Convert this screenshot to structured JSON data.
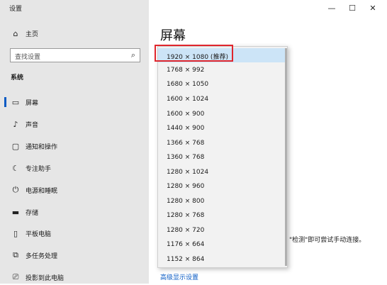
{
  "window": {
    "title": "设置",
    "controls": [
      "minimize-icon",
      "maximize-icon",
      "close-icon"
    ]
  },
  "sidebar": {
    "home": {
      "label": "主页",
      "icon": "home-icon"
    },
    "search": {
      "placeholder": "查找设置",
      "icon": "search-icon"
    },
    "section_title": "系统",
    "items": [
      {
        "label": "屏幕",
        "icon": "display-icon",
        "selected": true
      },
      {
        "label": "声音",
        "icon": "sound-icon"
      },
      {
        "label": "通知和操作",
        "icon": "notification-icon"
      },
      {
        "label": "专注助手",
        "icon": "moon-icon"
      },
      {
        "label": "电源和睡眠",
        "icon": "power-icon"
      },
      {
        "label": "存储",
        "icon": "storage-icon"
      },
      {
        "label": "平板电脑",
        "icon": "tablet-icon"
      },
      {
        "label": "多任务处理",
        "icon": "multitask-icon"
      },
      {
        "label": "投影到此电脑",
        "icon": "project-icon"
      }
    ]
  },
  "main": {
    "page_title": "屏幕",
    "hint_text": "\"检测\"即可尝试手动连接。",
    "advanced_link": "高级显示设置"
  },
  "resolution_dropdown": {
    "selected": "1920 × 1080 (推荐)",
    "options": [
      "1920 × 1080 (推荐)",
      "1768 × 992",
      "1680 × 1050",
      "1600 × 1024",
      "1600 × 900",
      "1440 × 900",
      "1366 × 768",
      "1360 × 768",
      "1280 × 1024",
      "1280 × 960",
      "1280 × 800",
      "1280 × 768",
      "1280 × 720",
      "1176 × 664",
      "1152 × 864"
    ]
  },
  "colors": {
    "accent": "#0a5bc4",
    "highlight_box": "#e0262d",
    "selected_option_bg": "#cce4f7",
    "sidebar_bg": "#e6e6e6"
  }
}
